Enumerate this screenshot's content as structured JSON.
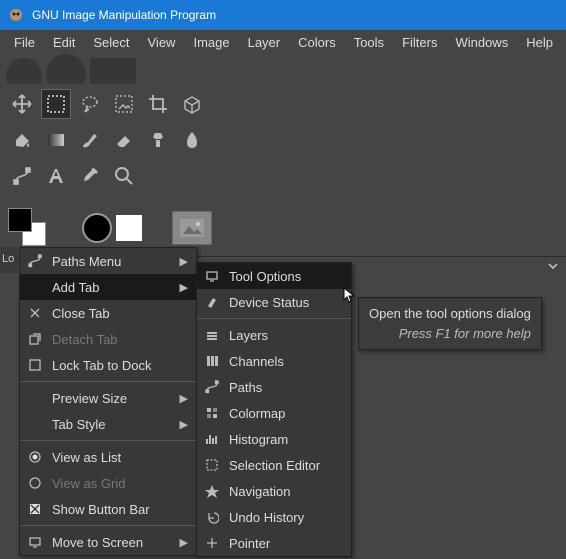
{
  "window": {
    "title": "GNU Image Manipulation Program"
  },
  "menubar": [
    "File",
    "Edit",
    "Select",
    "View",
    "Image",
    "Layer",
    "Colors",
    "Tools",
    "Filters",
    "Windows",
    "Help"
  ],
  "sidebar_stub": "Lo",
  "context_menu": {
    "items": [
      {
        "label": "Paths Menu",
        "icon": "paths-icon",
        "submenu": true
      },
      {
        "label": "Add Tab",
        "icon": "",
        "submenu": true,
        "highlight": true
      },
      {
        "label": "Close Tab",
        "icon": "close-icon"
      },
      {
        "label": "Detach Tab",
        "icon": "detach-icon",
        "disabled": true
      },
      {
        "label": "Lock Tab to Dock",
        "icon": "checkbox-off-icon"
      },
      {
        "sep": true
      },
      {
        "label": "Preview Size",
        "icon": "",
        "submenu": true
      },
      {
        "label": "Tab Style",
        "icon": "",
        "submenu": true
      },
      {
        "sep": true
      },
      {
        "label": "View as List",
        "icon": "radio-on-icon"
      },
      {
        "label": "View as Grid",
        "icon": "radio-off-icon",
        "disabled": true
      },
      {
        "label": "Show Button Bar",
        "icon": "checkbox-on-icon"
      },
      {
        "sep": true
      },
      {
        "label": "Move to Screen",
        "icon": "screen-icon",
        "submenu": true
      }
    ]
  },
  "submenu": {
    "items": [
      {
        "label": "Tool Options",
        "icon": "tool-options-icon",
        "highlight": true
      },
      {
        "label": "Device Status",
        "icon": "device-icon"
      },
      {
        "sep": true
      },
      {
        "label": "Layers",
        "icon": "layers-icon"
      },
      {
        "label": "Channels",
        "icon": "channels-icon"
      },
      {
        "label": "Paths",
        "icon": "paths-icon"
      },
      {
        "label": "Colormap",
        "icon": "colormap-icon"
      },
      {
        "label": "Histogram",
        "icon": "histogram-icon"
      },
      {
        "label": "Selection Editor",
        "icon": "selection-icon"
      },
      {
        "label": "Navigation",
        "icon": "navigation-icon"
      },
      {
        "label": "Undo History",
        "icon": "undo-icon"
      },
      {
        "label": "Pointer",
        "icon": "pointer-icon"
      }
    ]
  },
  "tooltip": {
    "main": "Open the tool options dialog",
    "hint": "Press F1 for more help"
  }
}
